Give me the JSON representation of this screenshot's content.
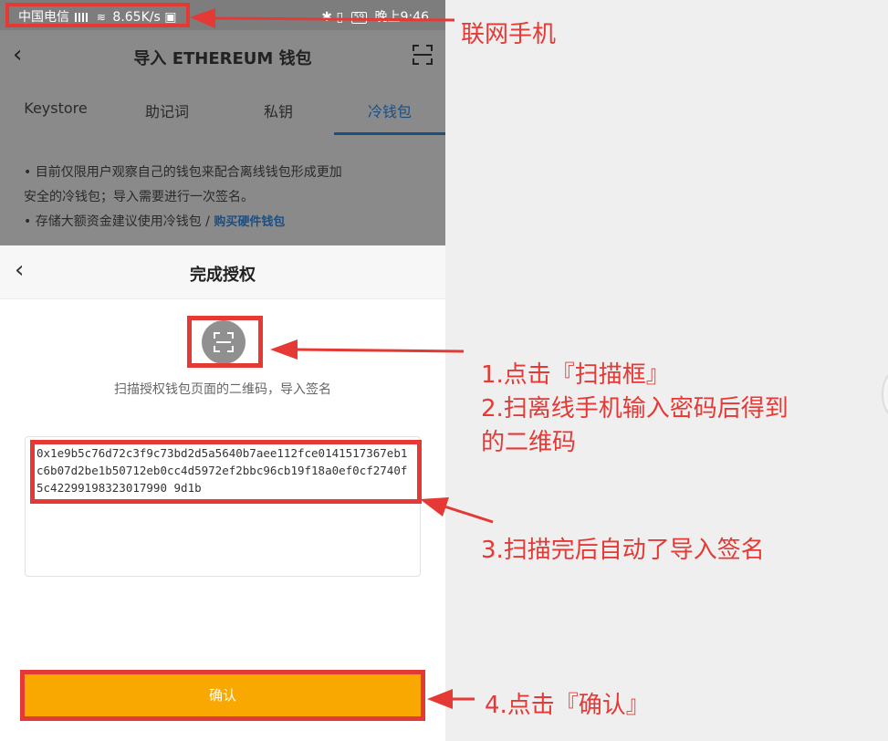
{
  "status_bar": {
    "carrier": "中国电信",
    "speed": "8.65K/s",
    "battery": "59",
    "time": "晚上9:46"
  },
  "nav": {
    "back_icon": "chevron-left-icon",
    "title": "导入 ETHEREUM 钱包",
    "scan_icon": "scan-icon"
  },
  "tabs": [
    {
      "label": "Keystore",
      "active": false
    },
    {
      "label": "助记词",
      "active": false
    },
    {
      "label": "私钥",
      "active": false
    },
    {
      "label": "冷钱包",
      "active": true
    }
  ],
  "notice": {
    "line1": "• 目前仅限用户观察自己的钱包来配合离线钱包形成更加",
    "line2": "安全的冷钱包；导入需要进行一次签名。",
    "line3_prefix": "• 存储大额资金建议使用冷钱包 / ",
    "line3_link": "购买硬件钱包"
  },
  "sheet": {
    "title": "完成授权",
    "hint": "扫描授权钱包页面的二维码，导入签名",
    "signature": "0x1e9b5c76d72c3f9c73bd2d5a5640b7aee112fce0141517367eb1c6b07d2be1b50712eb0cc4d5972ef2bbc96cb19f18a0ef0cf2740f5c42299198323017990 9d1b",
    "confirm_label": "确认"
  },
  "annotations": {
    "phone_label": "联网手机",
    "step1": "1.点击『扫描框』",
    "step2a": "2.扫离线手机输入密码后得到",
    "step2b": "的二维码",
    "step3": "3.扫描完后自动了导入签名",
    "step4": "4.点击『确认』"
  },
  "colors": {
    "highlight": "#e53935",
    "confirm_bg": "#f8a800",
    "link": "#1b4f82"
  }
}
